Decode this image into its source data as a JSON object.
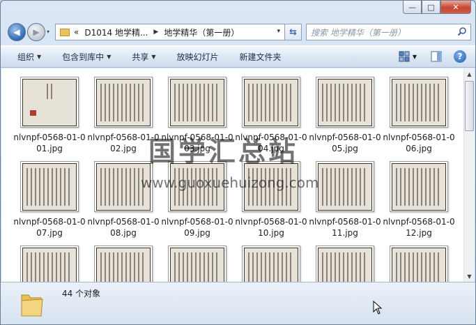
{
  "window": {
    "controls": {
      "minimize": "—",
      "maximize": "□",
      "close": "✕"
    }
  },
  "nav": {
    "back_icon": "arrow-left-icon",
    "forward_icon": "arrow-right-icon",
    "dropdown": "▾",
    "path_prefix": "«",
    "breadcrumbs": [
      "D1014 地学精...",
      "地学精华（第一册）"
    ],
    "crumb_sep": "▶",
    "address_dropdown": "▾",
    "refresh": "⇆",
    "search_placeholder": "搜索 地学精华（第一册）"
  },
  "toolbar": {
    "items": [
      {
        "label": "组织",
        "dropdown": true
      },
      {
        "label": "包含到库中",
        "dropdown": true
      },
      {
        "label": "共享",
        "dropdown": true
      },
      {
        "label": "放映幻灯片",
        "dropdown": false
      },
      {
        "label": "新建文件夹",
        "dropdown": false
      }
    ],
    "arrow": "▼",
    "right_icons": [
      "view-icon",
      "preview-pane-icon",
      "help-icon"
    ],
    "help": "?"
  },
  "files": [
    {
      "name": "nlvnpf-0568-01-001.jpg",
      "kind": "cover"
    },
    {
      "name": "nlvnpf-0568-01-002.jpg",
      "kind": "text"
    },
    {
      "name": "nlvnpf-0568-01-003.jpg",
      "kind": "text"
    },
    {
      "name": "nlvnpf-0568-01-004.jpg",
      "kind": "text"
    },
    {
      "name": "nlvnpf-0568-01-005.jpg",
      "kind": "text"
    },
    {
      "name": "nlvnpf-0568-01-006.jpg",
      "kind": "text"
    },
    {
      "name": "nlvnpf-0568-01-007.jpg",
      "kind": "text"
    },
    {
      "name": "nlvnpf-0568-01-008.jpg",
      "kind": "text"
    },
    {
      "name": "nlvnpf-0568-01-009.jpg",
      "kind": "text"
    },
    {
      "name": "nlvnpf-0568-01-010.jpg",
      "kind": "text"
    },
    {
      "name": "nlvnpf-0568-01-011.jpg",
      "kind": "text"
    },
    {
      "name": "nlvnpf-0568-01-012.jpg",
      "kind": "text"
    },
    {
      "name": "",
      "kind": "text"
    },
    {
      "name": "",
      "kind": "text"
    },
    {
      "name": "",
      "kind": "text"
    },
    {
      "name": "",
      "kind": "text"
    },
    {
      "name": "",
      "kind": "text"
    },
    {
      "name": "",
      "kind": "text"
    }
  ],
  "watermark": {
    "title": "国学汇总站",
    "url": "www.guoxuehuizong.com"
  },
  "details": {
    "count": "44 个对象"
  },
  "colors": {
    "seal": "#b13d2e",
    "accent": "#2f69b5",
    "paper": "#e7e2d8"
  }
}
